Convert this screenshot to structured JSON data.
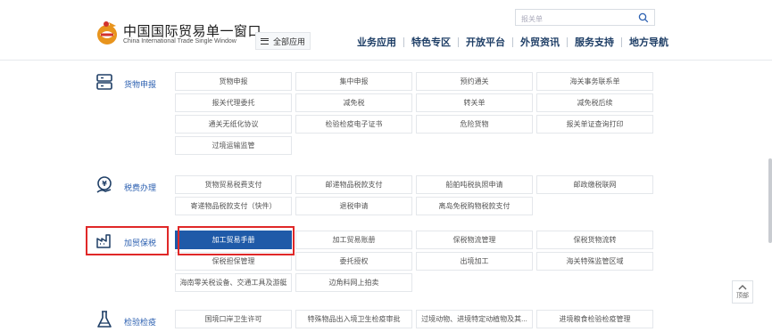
{
  "header": {
    "title": "中国国际贸易单一窗口",
    "subtitle": "China International Trade Single Window",
    "all_apps_label": "全部应用",
    "search_placeholder": "报关单",
    "nav": [
      "业务应用",
      "特色专区",
      "开放平台",
      "外贸资讯",
      "服务支持",
      "地方导航"
    ]
  },
  "sections": [
    {
      "label": "货物申报",
      "icon": "cargo-declaration-icon",
      "items": [
        "货物申报",
        "集中申报",
        "预约通关",
        "海关事务联系单",
        "报关代理委托",
        "减免税",
        "转关单",
        "减免税后续",
        "通关无纸化协议",
        "检验检疫电子证书",
        "危险货物",
        "报关单证查询打印",
        "过境运输监管"
      ]
    },
    {
      "label": "税费办理",
      "icon": "tax-payment-icon",
      "items": [
        "货物贸易税费支付",
        "邮递物品税款支付",
        "船舶吨税执照申请",
        "邮政缴税联网",
        "寄递物品税款支付（快件）",
        "退税申请",
        "离岛免税购物税款支付"
      ]
    },
    {
      "label": "加贸保税",
      "icon": "factory-icon",
      "items": [
        "加工贸易手册",
        "加工贸易账册",
        "保税物流管理",
        "保税货物流转",
        "保税担保管理",
        "委托授权",
        "出境加工",
        "海关特殊监管区域",
        "海南零关税设备、交通工具及游艇",
        "边角料网上拍卖"
      ],
      "active_index": 0
    },
    {
      "label": "检验检疫",
      "icon": "flask-icon",
      "items": [
        "国境口岸卫生许可",
        "特殊物品出入境卫生检疫审批",
        "过境动物、进境特定动植物及其...",
        "进境粮食检验检疫管理"
      ]
    }
  ],
  "top_button_label": "顶部",
  "colors": {
    "accent": "#1f5aa8",
    "highlight": "#e02828",
    "nav": "#1e3e66",
    "label": "#2b5fb0"
  }
}
